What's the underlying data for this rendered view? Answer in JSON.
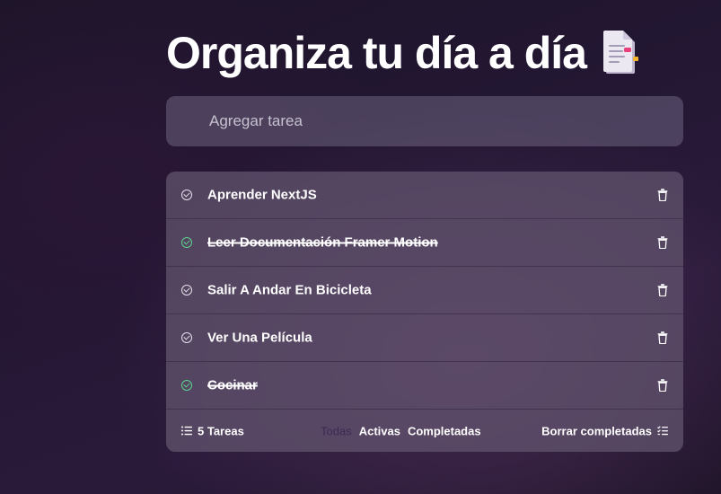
{
  "header": {
    "title": "Organiza tu día a día",
    "icon": "document-notepad-icon"
  },
  "new_task": {
    "placeholder": "Agregar tarea",
    "value": ""
  },
  "tasks": [
    {
      "label": "Aprender NextJS",
      "completed": false
    },
    {
      "label": "Leer Documentación Framer Motion",
      "completed": true
    },
    {
      "label": "Salir A Andar En Bicicleta",
      "completed": false
    },
    {
      "label": "Ver Una Película",
      "completed": false
    },
    {
      "label": "Cocinar",
      "completed": true
    }
  ],
  "footer": {
    "count_label": "5 Tareas",
    "filters": {
      "all": "Todas",
      "active": "Activas",
      "completed": "Completadas",
      "selected": "all"
    },
    "clear_label": "Borrar completadas"
  },
  "colors": {
    "completed_check": "#5fd38d",
    "active_filter": "#3c2a52",
    "panel_bg": "#645670"
  }
}
